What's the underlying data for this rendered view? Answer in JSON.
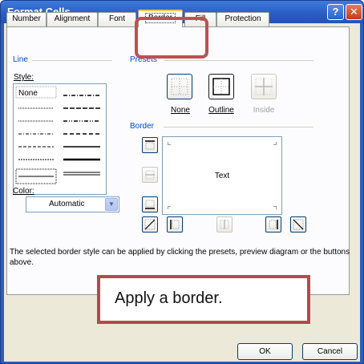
{
  "window": {
    "title": "Format Cells"
  },
  "tabs": [
    {
      "label": "Number"
    },
    {
      "label": "Alignment"
    },
    {
      "label": "Font"
    },
    {
      "label": "Border"
    },
    {
      "label": "Fill"
    },
    {
      "label": "Protection"
    }
  ],
  "active_tab": "Border",
  "line_group": {
    "label": "Line",
    "style_label": "Style:",
    "style_none": "None",
    "color_label": "Color:",
    "color_value": "Automatic"
  },
  "presets_group": {
    "label": "Presets",
    "none_label": "None",
    "outline_label": "Outline",
    "inside_label": "Inside"
  },
  "border_group": {
    "label": "Border",
    "preview_text": "Text"
  },
  "info_text": "The selected border style can be applied by clicking the presets, preview diagram or the buttons above.",
  "callout_text": "Apply a border.",
  "buttons": {
    "ok": "OK",
    "cancel": "Cancel"
  },
  "colors": {
    "titlebar": "#2a5cc4",
    "accent_highlight": "#c0504d",
    "group_label": "#0046d5"
  }
}
